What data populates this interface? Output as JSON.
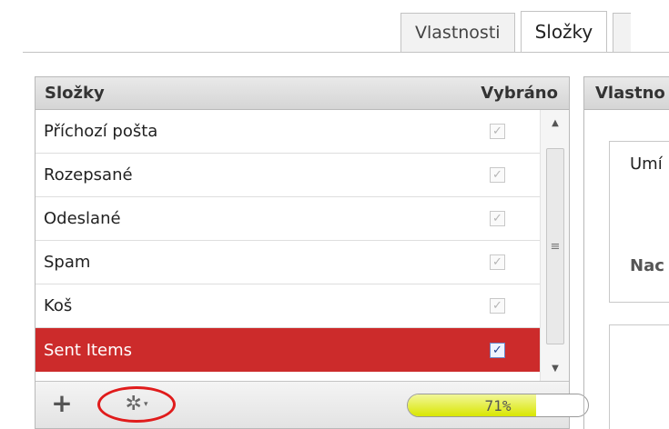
{
  "tabs": [
    {
      "label": "Vlastnosti"
    },
    {
      "label": "Složky"
    }
  ],
  "folders_panel": {
    "header_left": "Složky",
    "header_right": "Vybráno",
    "rows": [
      {
        "label": "Příchozí pošta",
        "checked": true,
        "selected": false
      },
      {
        "label": "Rozepsané",
        "checked": true,
        "selected": false
      },
      {
        "label": "Odeslané",
        "checked": true,
        "selected": false
      },
      {
        "label": "Spam",
        "checked": true,
        "selected": false
      },
      {
        "label": "Koš",
        "checked": true,
        "selected": false
      },
      {
        "label": "Sent Items",
        "checked": true,
        "selected": true
      }
    ],
    "checkmark": "✓",
    "scroll_grip": "≡",
    "footer": {
      "add_label": "+",
      "gear_icon": "gear-icon",
      "gear_glyph": "✲",
      "caret_glyph": "▾",
      "quota_text": "71%",
      "quota_fraction": 0.71
    }
  },
  "properties_panel": {
    "header": "Vlastno",
    "label_1": "Umí",
    "label_2": "Nac"
  },
  "colors": {
    "selected_row": "#cc2b2b",
    "highlight_ring": "#e01b1b",
    "quota_fill": "#d9e600"
  }
}
